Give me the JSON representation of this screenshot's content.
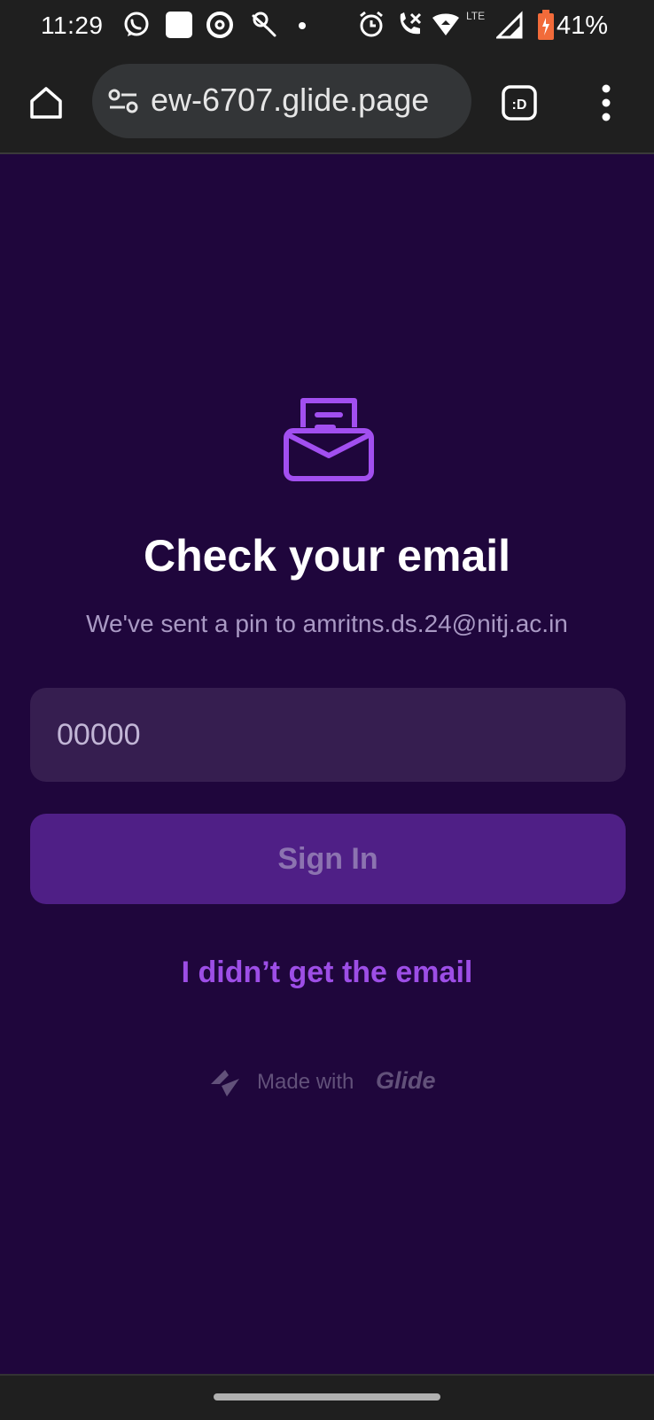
{
  "status_bar": {
    "time": "11:29",
    "lte": "LTE",
    "battery": "41%",
    "icons": [
      "whatsapp-icon",
      "app-square-icon",
      "threads-icon",
      "clock-notification-icon",
      "alarm-icon",
      "wifi-calling-icon",
      "hotspot-icon",
      "signal-icon",
      "battery-icon"
    ]
  },
  "browser": {
    "url": "ew-6707.glide.page",
    "extension_label": ":D"
  },
  "page": {
    "title": "Check your email",
    "subtitle": "We've sent a pin to amritns.ds.24@nitj.ac.in",
    "pin_placeholder": "00000",
    "pin_value": "",
    "signin_label": "Sign In",
    "resend_label": "I didn’t get the email",
    "made_with": "Made with",
    "brand": "Glide"
  },
  "colors": {
    "background": "#1f063c",
    "accent": "#9d4ee6",
    "button": "#4f1f86",
    "input": "#361e50"
  }
}
